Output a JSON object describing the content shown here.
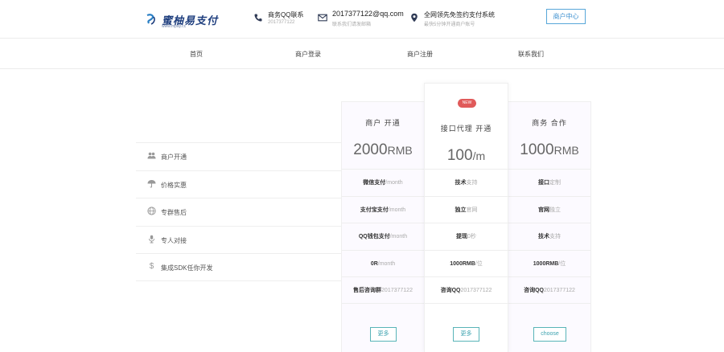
{
  "header": {
    "logo_text": "蜜柚易支付",
    "logo_sub": "www.mpay.cc",
    "qq": {
      "label": "商务QQ联系",
      "value": "2017377122",
      "icon": "phone-icon"
    },
    "email": {
      "label": "2017377122@qq.com",
      "value": "联系我们请发邮箱",
      "icon": "mail-icon"
    },
    "slogan": {
      "label": "全网领先免签约支付系统",
      "value": "最快5分钟开通商户账号",
      "icon": "location-icon"
    },
    "merchant_center": "商户中心",
    "accent": "#3b8fcf"
  },
  "nav": {
    "items": [
      {
        "label": "首页"
      },
      {
        "label": "商户登录"
      },
      {
        "label": "商户注册"
      },
      {
        "label": "联系我们"
      }
    ]
  },
  "features": [
    {
      "label": "商户开通",
      "icon": "users-icon"
    },
    {
      "label": "价格实惠",
      "icon": "umbrella-icon"
    },
    {
      "label": "专群售后",
      "icon": "globe-icon"
    },
    {
      "label": "专人对接",
      "icon": "person-icon"
    },
    {
      "label": "集成SDK任你开发",
      "icon": "dollar-icon"
    }
  ],
  "plans": [
    {
      "title": "商户 开通",
      "price": "2000",
      "unit": "RMB",
      "rows": [
        {
          "bold": "微信支付",
          "soft": "/month"
        },
        {
          "bold": "支付宝支付",
          "soft": "/month"
        },
        {
          "bold": "QQ钱包支付",
          "soft": "/month"
        },
        {
          "bold": "0R",
          "soft": "/month"
        },
        {
          "bold": "售后咨询群",
          "soft": "2017377122"
        }
      ],
      "button": "更多"
    },
    {
      "badge": "NEW",
      "title": "接口代理 开通",
      "price": "100",
      "unit": "/m",
      "rows": [
        {
          "bold": "技术",
          "soft": "支持"
        },
        {
          "bold": "独立",
          "soft": "官网"
        },
        {
          "bold": "提现",
          "soft": "0秒"
        },
        {
          "bold": "1000RMB",
          "soft": "/位"
        },
        {
          "bold": "咨询QQ",
          "soft": "2017377122"
        }
      ],
      "button": "更多"
    },
    {
      "title": "商务 合作",
      "price": "1000",
      "unit": "RMB",
      "rows": [
        {
          "bold": "接口",
          "soft": "定制"
        },
        {
          "bold": "官网",
          "soft": "独立"
        },
        {
          "bold": "技术",
          "soft": "支持"
        },
        {
          "bold": "1000RMB",
          "soft": "/位"
        },
        {
          "bold": "咨询QQ",
          "soft": "2017377122"
        }
      ],
      "button": "choose"
    }
  ]
}
